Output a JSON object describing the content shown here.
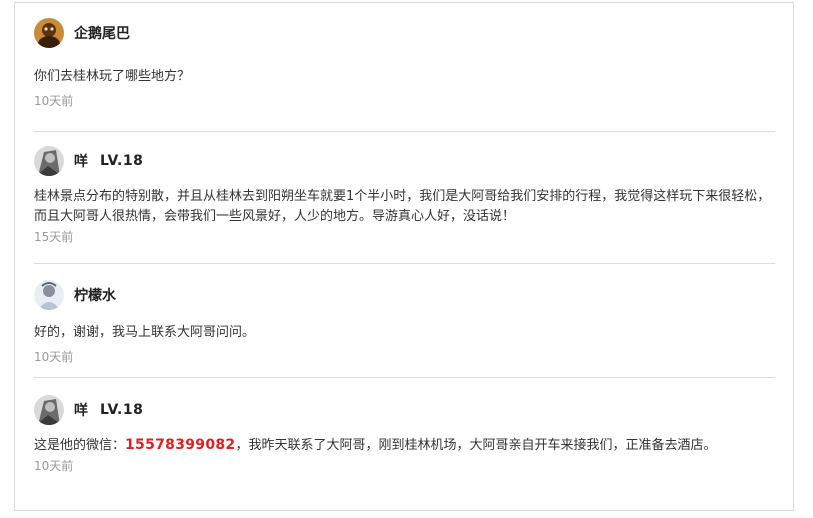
{
  "comments": [
    {
      "user": "企鹅尾巴",
      "level": "",
      "text": "你们去桂林玩了哪些地方？",
      "time": "10天前",
      "avatar_icon": "penguin-avatar-icon"
    },
    {
      "user": "咩",
      "level": "LV.18",
      "text": "桂林景点分布的特别散，并且从桂林去到阳朔坐车就要1个半小时，我们是大阿哥给我们安排的行程，我觉得这样玩下来很轻松，而且大阿哥人很热情，会带我们一些风景好，人少的地方。导游真心人好，没话说！",
      "time": "15天前",
      "avatar_icon": "person-avatar-icon"
    },
    {
      "user": "柠檬水",
      "level": "",
      "text": "好的，谢谢，我马上联系大阿哥问问。",
      "time": "10天前",
      "avatar_icon": "person-avatar-icon"
    },
    {
      "user": "咩",
      "level": "LV.18",
      "text_before": "这是他的微信：",
      "phone": "15578399082",
      "text_after": "，我昨天联系了大阿哥，刚到桂林机场，大阿哥亲自开车来接我们，正准备去酒店。",
      "time": "10天前",
      "avatar_icon": "person-avatar-icon"
    }
  ],
  "colors": {
    "phone": "#e0201f",
    "time": "#999999",
    "divider": "#dddddd"
  }
}
